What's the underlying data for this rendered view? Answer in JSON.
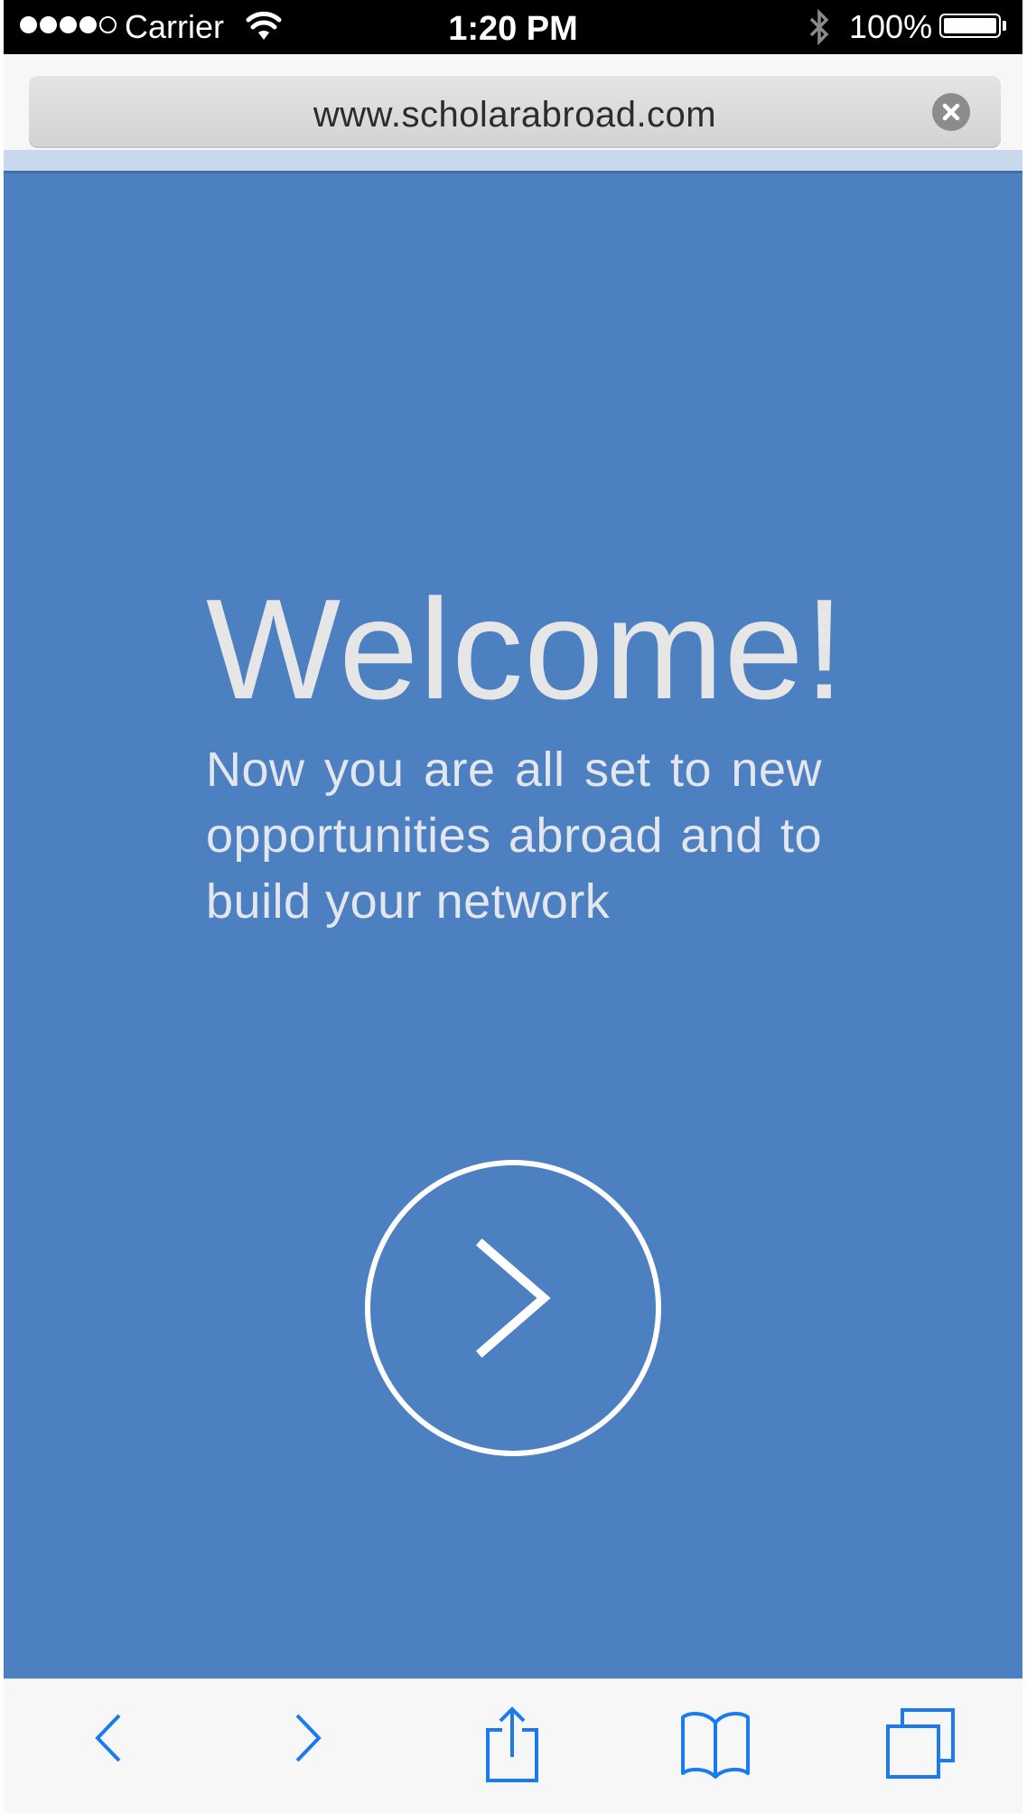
{
  "status_bar": {
    "carrier": "Carrier",
    "time": "1:20 PM",
    "battery_percent": "100%",
    "signal_bars_filled": 4,
    "signal_bars_total": 5,
    "battery_level": 1.0
  },
  "browser": {
    "url": "www.scholarabroad.com"
  },
  "main": {
    "heading": "Welcome!",
    "body": "Now you are all set to new opportunities abroad and to build your network",
    "background_color": "#4d80c1",
    "next_button_icon": "chevron-right-icon"
  },
  "toolbar": {
    "accent_color": "#1a7bf0",
    "icons": [
      "back-icon",
      "forward-icon",
      "share-icon",
      "bookmarks-icon",
      "tabs-icon"
    ]
  }
}
